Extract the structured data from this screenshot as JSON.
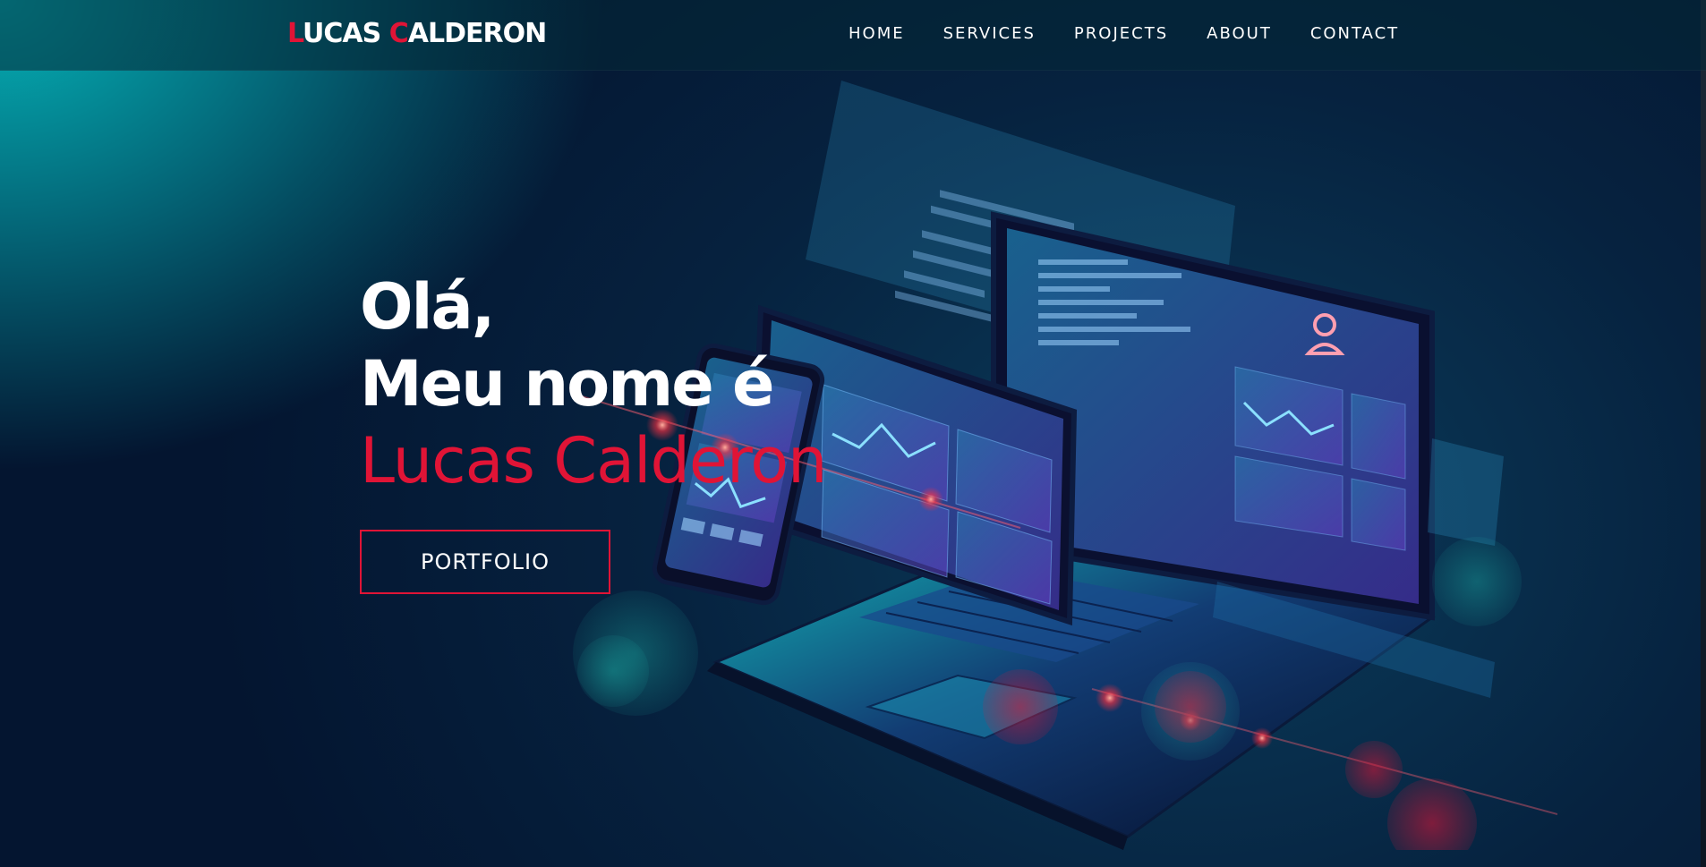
{
  "navbar": {
    "brand_first_initial": "L",
    "brand_first_rest": "UCAS ",
    "brand_last_initial": "C",
    "brand_last_rest": "ALDERON",
    "links": [
      {
        "label": "HOME"
      },
      {
        "label": "SERVICES"
      },
      {
        "label": "PROJECTS"
      },
      {
        "label": "ABOUT"
      },
      {
        "label": "CONTACT"
      }
    ]
  },
  "hero": {
    "greeting": "Olá,",
    "intro": "Meu nome é",
    "name": "Lucas Calderon",
    "button_label": "PORTFOLIO"
  },
  "colors": {
    "accent": "#e01436",
    "text": "#ffffff",
    "background_teal": "#05b3b8",
    "background_navy": "#041530"
  },
  "icons": {
    "hero_illustration": "devices-illustration"
  }
}
